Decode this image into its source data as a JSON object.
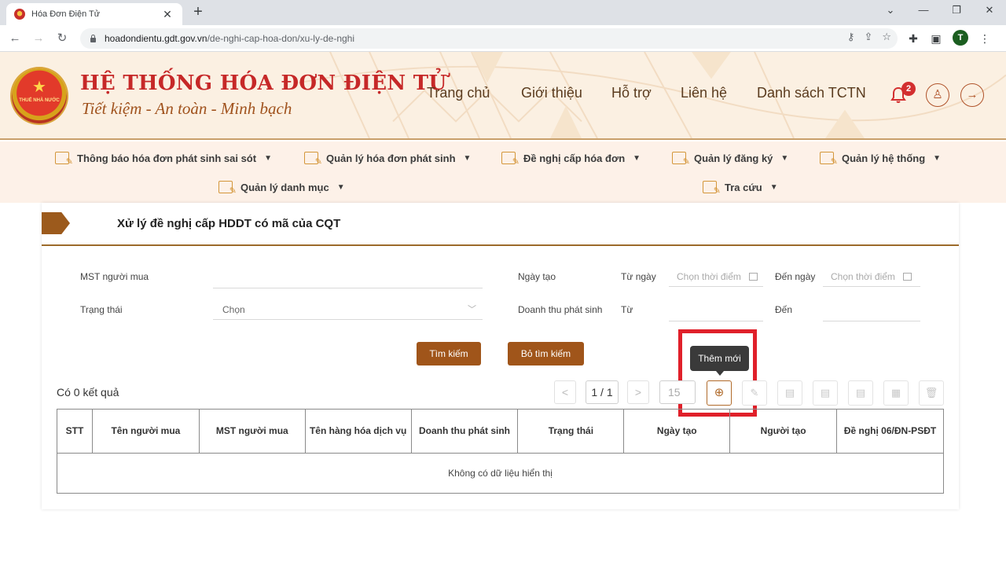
{
  "browser": {
    "tab_title": "Hóa Đơn Điện Tử",
    "url_host": "hoadondientu.gdt.gov.vn",
    "url_path": "/de-nghi-cap-hoa-don/xu-ly-de-nghi",
    "profile_initial": "T"
  },
  "header": {
    "emblem_text": "THUẾ NHÀ NƯỚC",
    "title": "HỆ THỐNG HÓA ĐƠN ĐIỆN TỬ",
    "slogan": "Tiết kiệm - An toàn - Minh bạch",
    "nav": [
      "Trang chủ",
      "Giới thiệu",
      "Hỗ trợ",
      "Liên hệ",
      "Danh sách TCTN"
    ],
    "notification_count": "2",
    "accent_color": "#c62828"
  },
  "menu": {
    "items": [
      "Thông báo hóa đơn phát sinh sai sót",
      "Quản lý hóa đơn phát sinh",
      "Đề nghị cấp hóa đơn",
      "Quản lý đăng ký",
      "Quản lý hệ thống",
      "Quản lý danh mục",
      "Tra cứu"
    ]
  },
  "page": {
    "title": "Xử lý đề nghị cấp HDDT có mã của CQT"
  },
  "filters": {
    "buyer_tax_label": "MST người mua",
    "status_label": "Trạng thái",
    "status_placeholder": "Chọn",
    "created_date_label": "Ngày tạo",
    "from_date_label": "Từ ngày",
    "to_date_label": "Đến ngày",
    "date_placeholder": "Chọn thời điểm",
    "revenue_label": "Doanh thu phát sinh",
    "from_label": "Từ",
    "to_label": "Đến",
    "search_button": "Tìm kiếm",
    "clear_button": "Bỏ tìm kiếm"
  },
  "results": {
    "count_text": "Có 0 kết quả",
    "page_text": "1 / 1",
    "page_size": "15",
    "add_tooltip": "Thêm mới"
  },
  "table": {
    "columns": [
      "STT",
      "Tên người mua",
      "MST người mua",
      "Tên hàng hóa dịch vụ",
      "Doanh thu phát sinh",
      "Trạng thái",
      "Ngày tạo",
      "Người tạo",
      "Đề nghị 06/ĐN-PSĐT"
    ],
    "empty_text": "Không có dữ liệu hiển thị"
  }
}
